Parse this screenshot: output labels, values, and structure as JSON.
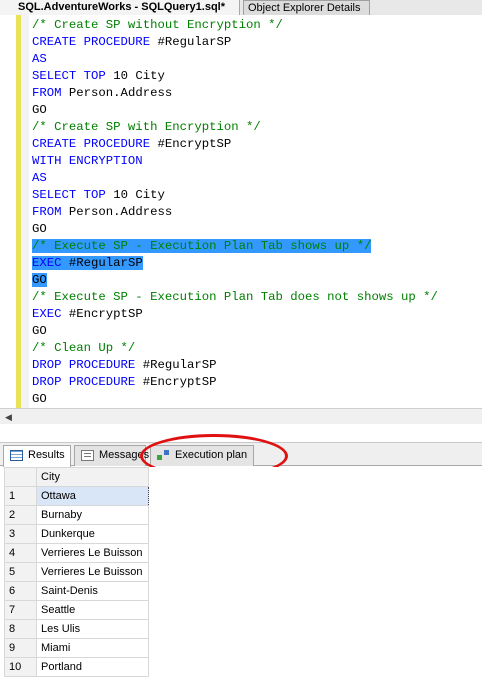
{
  "tabs": {
    "active": "SQL.AdventureWorks - SQLQuery1.sql*",
    "inactive": "Object Explorer Details"
  },
  "editor": {
    "lines": [
      [
        {
          "t": "/* Create SP without Encryption */",
          "c": "comment"
        }
      ],
      [
        {
          "t": "CREATE PROCEDURE ",
          "c": "keyword"
        },
        {
          "t": "#RegularSP",
          "c": "ident"
        }
      ],
      [
        {
          "t": "AS",
          "c": "keyword"
        }
      ],
      [
        {
          "t": "SELECT TOP ",
          "c": "keyword"
        },
        {
          "t": "10 City",
          "c": "ident"
        }
      ],
      [
        {
          "t": "FROM ",
          "c": "keyword"
        },
        {
          "t": "Person.Address",
          "c": "ident"
        }
      ],
      [
        {
          "t": "GO",
          "c": "ident"
        }
      ],
      [
        {
          "t": "/* Create SP with Encryption */",
          "c": "comment"
        }
      ],
      [
        {
          "t": "CREATE PROCEDURE ",
          "c": "keyword"
        },
        {
          "t": "#EncryptSP",
          "c": "ident"
        }
      ],
      [
        {
          "t": "WITH ENCRYPTION",
          "c": "keyword"
        }
      ],
      [
        {
          "t": "AS",
          "c": "keyword"
        }
      ],
      [
        {
          "t": "SELECT TOP ",
          "c": "keyword"
        },
        {
          "t": "10 City",
          "c": "ident"
        }
      ],
      [
        {
          "t": "FROM ",
          "c": "keyword"
        },
        {
          "t": "Person.Address",
          "c": "ident"
        }
      ],
      [
        {
          "t": "GO",
          "c": "ident"
        }
      ],
      [
        {
          "t": "/* Execute SP - Execution Plan Tab shows up */",
          "c": "comment",
          "sel": true
        }
      ],
      [
        {
          "t": "EXEC ",
          "c": "keyword",
          "sel": true
        },
        {
          "t": "#RegularSP",
          "c": "ident",
          "sel": true
        }
      ],
      [
        {
          "t": "GO",
          "c": "ident",
          "sel": true
        }
      ],
      [
        {
          "t": "/* Execute SP - Execution Plan Tab does not shows up */",
          "c": "comment"
        }
      ],
      [
        {
          "t": "EXEC ",
          "c": "keyword"
        },
        {
          "t": "#EncryptSP",
          "c": "ident"
        }
      ],
      [
        {
          "t": "GO",
          "c": "ident"
        }
      ],
      [
        {
          "t": "/* Clean Up */",
          "c": "comment"
        }
      ],
      [
        {
          "t": "DROP PROCEDURE ",
          "c": "keyword"
        },
        {
          "t": "#RegularSP",
          "c": "ident"
        }
      ],
      [
        {
          "t": "DROP PROCEDURE ",
          "c": "keyword"
        },
        {
          "t": "#EncryptSP",
          "c": "ident"
        }
      ],
      [
        {
          "t": "GO",
          "c": "ident"
        }
      ]
    ]
  },
  "results_tabs": {
    "results": "Results",
    "messages": "Messages",
    "execution_plan": "Execution plan"
  },
  "grid": {
    "column": "City",
    "rows": [
      {
        "n": "1",
        "city": "Ottawa"
      },
      {
        "n": "2",
        "city": "Burnaby"
      },
      {
        "n": "3",
        "city": "Dunkerque"
      },
      {
        "n": "4",
        "city": "Verrieres Le Buisson"
      },
      {
        "n": "5",
        "city": "Verrieres Le Buisson"
      },
      {
        "n": "6",
        "city": "Saint-Denis"
      },
      {
        "n": "7",
        "city": "Seattle"
      },
      {
        "n": "8",
        "city": "Les Ulis"
      },
      {
        "n": "9",
        "city": "Miami"
      },
      {
        "n": "10",
        "city": "Portland"
      }
    ]
  },
  "colors": {
    "comment": "#008000",
    "keyword": "#0000ff",
    "selection": "#3399ff",
    "annotation": "#e01010"
  },
  "icons": {
    "results": "grid-icon",
    "messages": "message-icon",
    "execution_plan": "execution-plan-icon"
  }
}
